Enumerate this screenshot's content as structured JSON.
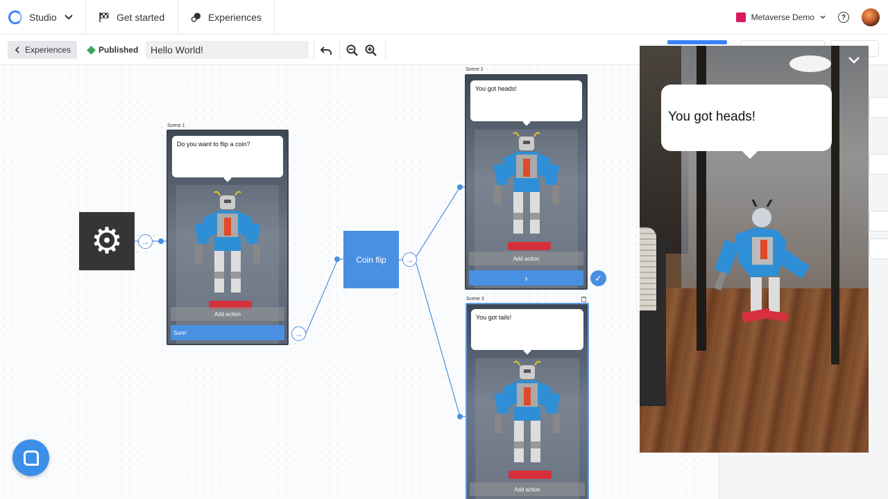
{
  "nav": {
    "studio_label": "Studio",
    "get_started_label": "Get started",
    "experiences_label": "Experiences",
    "workspace_name": "Metaverse Demo",
    "workspace_color": "#d81b60",
    "help_glyph": "?"
  },
  "toolbar": {
    "back_label": "Experiences",
    "status_label": "Published",
    "status_color": "#3aa35b",
    "title_value": "Hello World!"
  },
  "canvas": {
    "trigger_icon": "gear-icon",
    "scene1": {
      "label": "Scene 1",
      "bubble_text": "Do you want to flip a coin?",
      "add_action_label": "Add action",
      "choice_label": "Sure!"
    },
    "coin_flip_label": "Coin flip",
    "scene2": {
      "label": "Scene 2",
      "bubble_text": "You got heads!",
      "add_action_label": "Add action",
      "choice_glyph": "›"
    },
    "scene3": {
      "label": "Scene 3",
      "bubble_text": "You got tails!",
      "add_action_label": "Add action"
    },
    "accent_color": "#4a90e2"
  },
  "preview": {
    "bubble_text": "You got heads!",
    "close_glyph": "⌄"
  }
}
